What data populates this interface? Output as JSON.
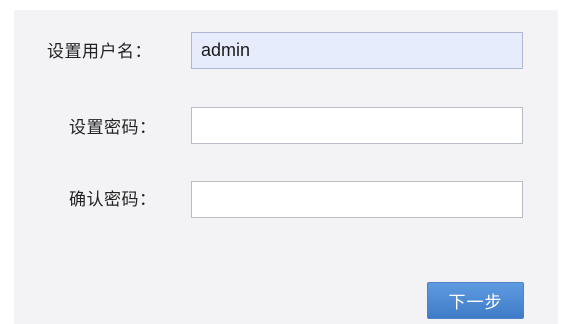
{
  "form": {
    "username": {
      "label": "设置用户名：",
      "value": "admin"
    },
    "password": {
      "label": "设置密码：",
      "value": ""
    },
    "confirm_password": {
      "label": "确认密码：",
      "value": ""
    },
    "next_button_label": "下一步"
  },
  "colors": {
    "panel_background": "#f3f3f5",
    "autofill_field_background": "#e6ecfb",
    "button_background": "#4a89d2",
    "button_text": "#ffffff"
  }
}
